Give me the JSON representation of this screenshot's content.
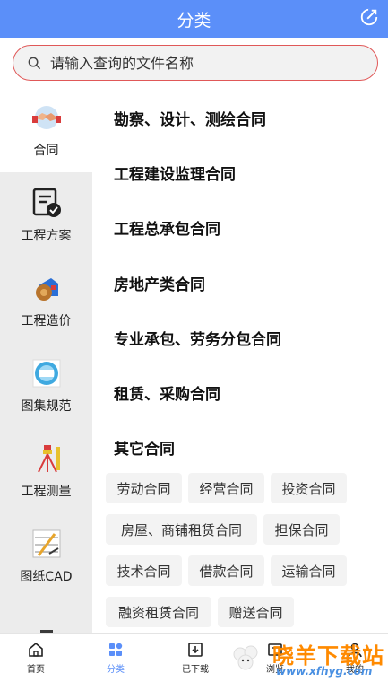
{
  "header": {
    "title": "分类"
  },
  "search": {
    "placeholder": "请输入查询的文件名称"
  },
  "sidebar": {
    "items": [
      {
        "label": "合同",
        "icon": "handshake-icon",
        "active": true
      },
      {
        "label": "工程方案",
        "icon": "document-check-icon",
        "active": false
      },
      {
        "label": "工程造价",
        "icon": "money-bag-icon",
        "active": false
      },
      {
        "label": "图集规范",
        "icon": "atlas-icon",
        "active": false
      },
      {
        "label": "工程测量",
        "icon": "surveying-tripod-icon",
        "active": false
      },
      {
        "label": "图纸CAD",
        "icon": "drawing-tools-icon",
        "active": false
      }
    ]
  },
  "content": {
    "categories": [
      "勘察、设计、测绘合同",
      "工程建设监理合同",
      "工程总承包合同",
      "房地产类合同",
      "专业承包、劳务分包合同",
      "租赁、采购合同",
      "其它合同"
    ],
    "tags": [
      "劳动合同",
      "经营合同",
      "投资合同",
      "房屋、商铺租赁合同",
      "担保合同",
      "技术合同",
      "借款合同",
      "运输合同",
      "融资租赁合同",
      "赠送合同"
    ]
  },
  "tabbar": {
    "tabs": [
      {
        "label": "首页",
        "icon": "home-icon"
      },
      {
        "label": "分类",
        "icon": "category-icon",
        "active": true
      },
      {
        "label": "已下载",
        "icon": "download-icon"
      },
      {
        "label": "浏览",
        "icon": "browse-icon"
      },
      {
        "label": "我的",
        "icon": "user-icon"
      }
    ]
  },
  "watermark": {
    "name": "晓羊下载站",
    "url": "www.xfhyg.com"
  },
  "colors": {
    "accent": "#5b8ff9",
    "search_border": "#e05858",
    "sidebar_bg": "#ececec"
  }
}
